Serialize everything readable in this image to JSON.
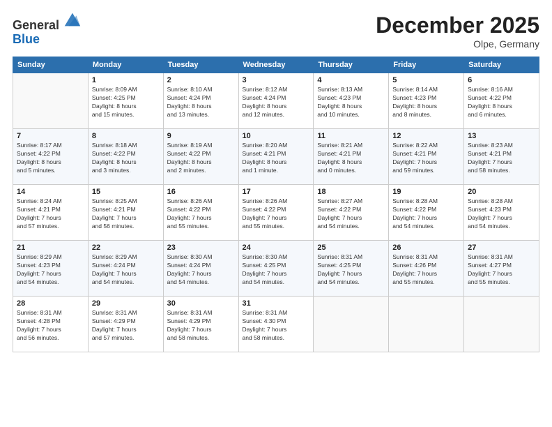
{
  "header": {
    "logo_line1": "General",
    "logo_line2": "Blue",
    "month": "December 2025",
    "location": "Olpe, Germany"
  },
  "weekdays": [
    "Sunday",
    "Monday",
    "Tuesday",
    "Wednesday",
    "Thursday",
    "Friday",
    "Saturday"
  ],
  "weeks": [
    [
      {
        "day": "",
        "info": ""
      },
      {
        "day": "1",
        "info": "Sunrise: 8:09 AM\nSunset: 4:25 PM\nDaylight: 8 hours\nand 15 minutes."
      },
      {
        "day": "2",
        "info": "Sunrise: 8:10 AM\nSunset: 4:24 PM\nDaylight: 8 hours\nand 13 minutes."
      },
      {
        "day": "3",
        "info": "Sunrise: 8:12 AM\nSunset: 4:24 PM\nDaylight: 8 hours\nand 12 minutes."
      },
      {
        "day": "4",
        "info": "Sunrise: 8:13 AM\nSunset: 4:23 PM\nDaylight: 8 hours\nand 10 minutes."
      },
      {
        "day": "5",
        "info": "Sunrise: 8:14 AM\nSunset: 4:23 PM\nDaylight: 8 hours\nand 8 minutes."
      },
      {
        "day": "6",
        "info": "Sunrise: 8:16 AM\nSunset: 4:22 PM\nDaylight: 8 hours\nand 6 minutes."
      }
    ],
    [
      {
        "day": "7",
        "info": "Sunrise: 8:17 AM\nSunset: 4:22 PM\nDaylight: 8 hours\nand 5 minutes."
      },
      {
        "day": "8",
        "info": "Sunrise: 8:18 AM\nSunset: 4:22 PM\nDaylight: 8 hours\nand 3 minutes."
      },
      {
        "day": "9",
        "info": "Sunrise: 8:19 AM\nSunset: 4:22 PM\nDaylight: 8 hours\nand 2 minutes."
      },
      {
        "day": "10",
        "info": "Sunrise: 8:20 AM\nSunset: 4:21 PM\nDaylight: 8 hours\nand 1 minute."
      },
      {
        "day": "11",
        "info": "Sunrise: 8:21 AM\nSunset: 4:21 PM\nDaylight: 8 hours\nand 0 minutes."
      },
      {
        "day": "12",
        "info": "Sunrise: 8:22 AM\nSunset: 4:21 PM\nDaylight: 7 hours\nand 59 minutes."
      },
      {
        "day": "13",
        "info": "Sunrise: 8:23 AM\nSunset: 4:21 PM\nDaylight: 7 hours\nand 58 minutes."
      }
    ],
    [
      {
        "day": "14",
        "info": "Sunrise: 8:24 AM\nSunset: 4:21 PM\nDaylight: 7 hours\nand 57 minutes."
      },
      {
        "day": "15",
        "info": "Sunrise: 8:25 AM\nSunset: 4:21 PM\nDaylight: 7 hours\nand 56 minutes."
      },
      {
        "day": "16",
        "info": "Sunrise: 8:26 AM\nSunset: 4:22 PM\nDaylight: 7 hours\nand 55 minutes."
      },
      {
        "day": "17",
        "info": "Sunrise: 8:26 AM\nSunset: 4:22 PM\nDaylight: 7 hours\nand 55 minutes."
      },
      {
        "day": "18",
        "info": "Sunrise: 8:27 AM\nSunset: 4:22 PM\nDaylight: 7 hours\nand 54 minutes."
      },
      {
        "day": "19",
        "info": "Sunrise: 8:28 AM\nSunset: 4:22 PM\nDaylight: 7 hours\nand 54 minutes."
      },
      {
        "day": "20",
        "info": "Sunrise: 8:28 AM\nSunset: 4:23 PM\nDaylight: 7 hours\nand 54 minutes."
      }
    ],
    [
      {
        "day": "21",
        "info": "Sunrise: 8:29 AM\nSunset: 4:23 PM\nDaylight: 7 hours\nand 54 minutes."
      },
      {
        "day": "22",
        "info": "Sunrise: 8:29 AM\nSunset: 4:24 PM\nDaylight: 7 hours\nand 54 minutes."
      },
      {
        "day": "23",
        "info": "Sunrise: 8:30 AM\nSunset: 4:24 PM\nDaylight: 7 hours\nand 54 minutes."
      },
      {
        "day": "24",
        "info": "Sunrise: 8:30 AM\nSunset: 4:25 PM\nDaylight: 7 hours\nand 54 minutes."
      },
      {
        "day": "25",
        "info": "Sunrise: 8:31 AM\nSunset: 4:25 PM\nDaylight: 7 hours\nand 54 minutes."
      },
      {
        "day": "26",
        "info": "Sunrise: 8:31 AM\nSunset: 4:26 PM\nDaylight: 7 hours\nand 55 minutes."
      },
      {
        "day": "27",
        "info": "Sunrise: 8:31 AM\nSunset: 4:27 PM\nDaylight: 7 hours\nand 55 minutes."
      }
    ],
    [
      {
        "day": "28",
        "info": "Sunrise: 8:31 AM\nSunset: 4:28 PM\nDaylight: 7 hours\nand 56 minutes."
      },
      {
        "day": "29",
        "info": "Sunrise: 8:31 AM\nSunset: 4:29 PM\nDaylight: 7 hours\nand 57 minutes."
      },
      {
        "day": "30",
        "info": "Sunrise: 8:31 AM\nSunset: 4:29 PM\nDaylight: 7 hours\nand 58 minutes."
      },
      {
        "day": "31",
        "info": "Sunrise: 8:31 AM\nSunset: 4:30 PM\nDaylight: 7 hours\nand 58 minutes."
      },
      {
        "day": "",
        "info": ""
      },
      {
        "day": "",
        "info": ""
      },
      {
        "day": "",
        "info": ""
      }
    ]
  ]
}
